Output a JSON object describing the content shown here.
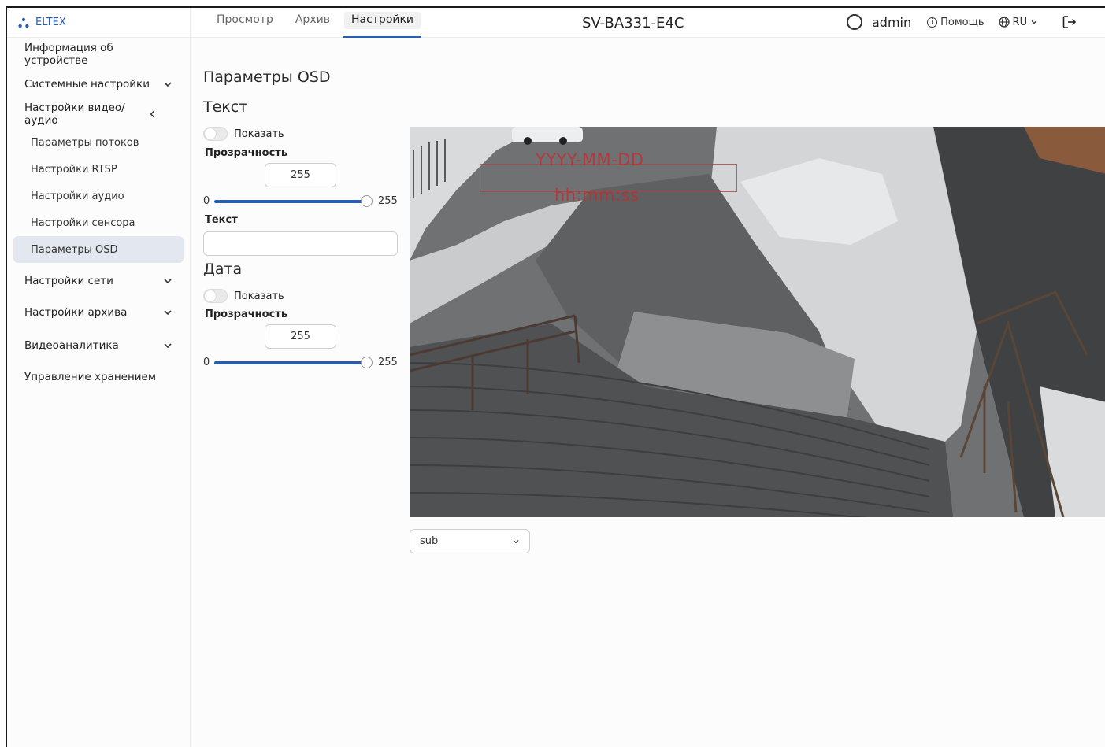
{
  "header": {
    "brand": "ELTEX",
    "tabs": [
      {
        "label": "Просмотр",
        "active": false
      },
      {
        "label": "Архив",
        "active": false
      },
      {
        "label": "Настройки",
        "active": true
      }
    ],
    "device_title": "SV-BA331-E4C",
    "user": "admin",
    "help_label": "Помощь",
    "lang_label": "RU",
    "accent_color": "#2a5db0"
  },
  "sidebar": {
    "items": [
      {
        "label": "Информация об устройстве"
      },
      {
        "label": "Системные настройки",
        "chevron": "chevron-down-icon"
      },
      {
        "label": "Настройки видео/аудио",
        "chevron": "chevron-left-icon"
      },
      {
        "label": "Параметры потоков"
      },
      {
        "label": "Настройки RTSP"
      },
      {
        "label": "Настройки аудио"
      },
      {
        "label": "Настройки сенсора"
      },
      {
        "label": "Параметры OSD",
        "active": true
      },
      {
        "label": "Настройки сети",
        "chevron": "chevron-down-icon"
      },
      {
        "label": "Настройки архива",
        "chevron": "chevron-down-icon"
      },
      {
        "label": "Видеоаналитика",
        "chevron": "chevron-down-icon"
      },
      {
        "label": "Управление хранением"
      }
    ]
  },
  "main": {
    "page_title": "Параметры OSD",
    "text_section": {
      "title": "Текст",
      "show_label": "Показать",
      "show_enabled": false,
      "transparency_label": "Прозрачность",
      "transparency_value": "255",
      "slider_min": "0",
      "slider_max": "255",
      "slider_level": 1.0,
      "text_label": "Текст",
      "text_value": ""
    },
    "date_section": {
      "title": "Дата",
      "show_label": "Показать",
      "show_enabled": false,
      "transparency_label": "Прозрачность",
      "transparency_value": "255",
      "slider_min": "0",
      "slider_max": "255",
      "slider_level": 1.0
    },
    "video": {
      "osd_date": "YYYY-MM-DD",
      "osd_time": "hh:mm:ss"
    },
    "stream_select": {
      "value": "sub"
    }
  }
}
